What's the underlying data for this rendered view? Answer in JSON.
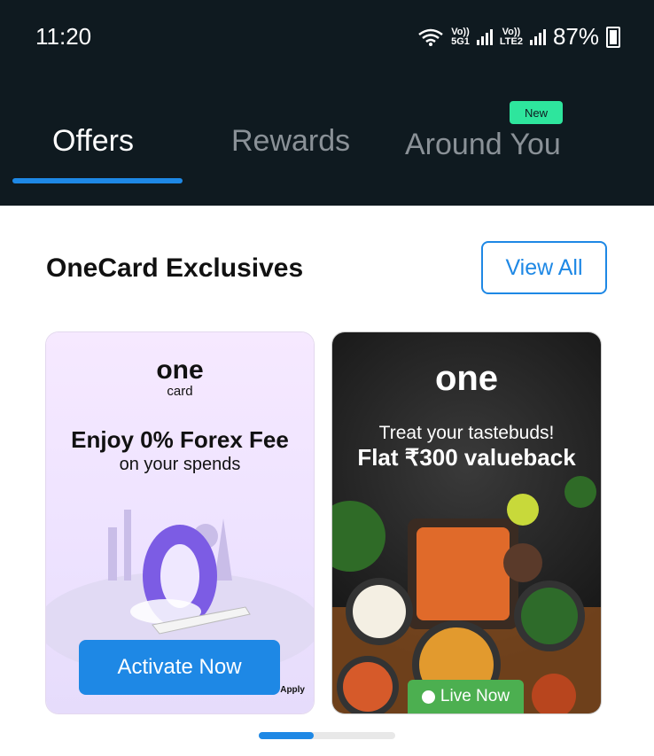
{
  "status_bar": {
    "time": "11:20",
    "sim1_top": "Vo))",
    "sim1_bottom": "5G1",
    "sim2_top": "Vo))",
    "sim2_bottom": "LTE2",
    "battery": "87%"
  },
  "tabs": [
    {
      "label": "Offers",
      "active": true
    },
    {
      "label": "Rewards",
      "active": false
    },
    {
      "label": "Around You",
      "active": false,
      "badge": "New"
    }
  ],
  "section": {
    "title": "OneCard Exclusives",
    "view_all_label": "View All"
  },
  "cards": [
    {
      "logo": "one",
      "logo_sub": "card",
      "headline": "Enjoy 0% Forex Fee",
      "subline": "on your spends",
      "button_label": "Activate Now",
      "footnote": "Apply"
    },
    {
      "logo": "one",
      "line1": "Treat your tastebuds!",
      "line2": "Flat ₹300 valueback",
      "badge": "Live Now"
    }
  ],
  "colors": {
    "accent": "#1e88e5",
    "header_bg": "#0f1a20",
    "new_badge": "#2ee59d",
    "live_badge": "#4caf50"
  },
  "carousel": {
    "pages": 2,
    "active_page": 1
  }
}
